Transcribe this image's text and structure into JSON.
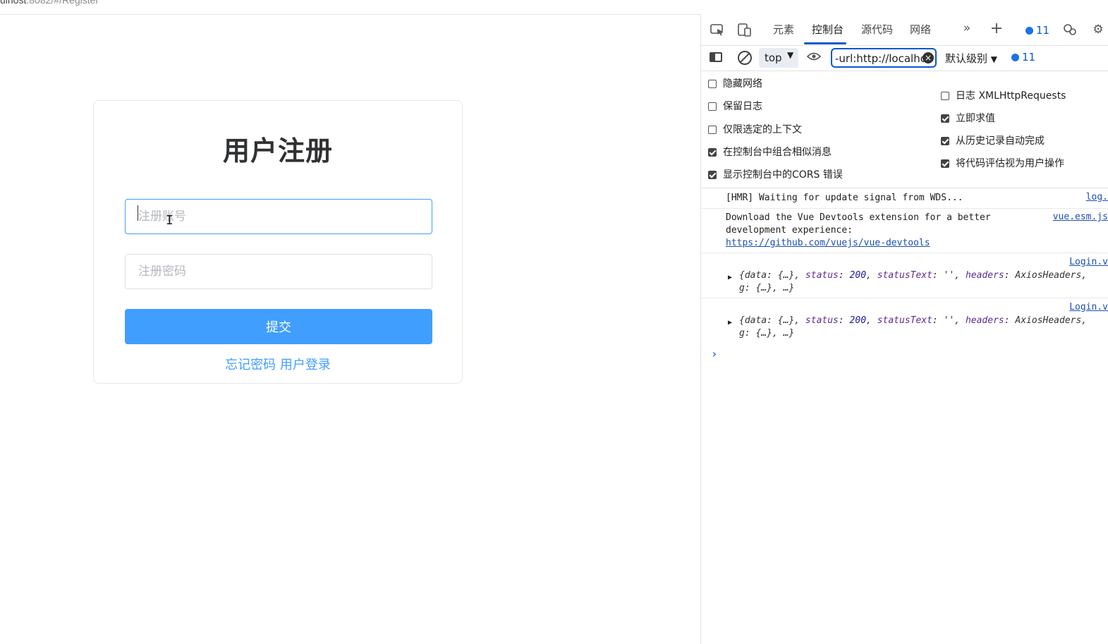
{
  "browser": {
    "url_host": "ulhost",
    "url_dim": ":8082/#/Register"
  },
  "register": {
    "title": "用户注册",
    "username_placeholder": "注册账号",
    "password_placeholder": "注册密码",
    "submit_label": "提交",
    "forgot_label": "忘记密码",
    "login_label": "用户登录"
  },
  "devtools": {
    "tabs": [
      "元素",
      "控制台",
      "源代码",
      "网络"
    ],
    "active_tab": "控制台",
    "issue_count": "11",
    "toolbar": {
      "context": "top",
      "filter_value": "-url:http://localhos",
      "level": "默认级别",
      "message_count": "11"
    },
    "settings_left": [
      {
        "label": "隐藏网络",
        "checked": false
      },
      {
        "label": "保留日志",
        "checked": false
      },
      {
        "label": "仅限选定的上下文",
        "checked": false
      },
      {
        "label": "在控制台中组合相似消息",
        "checked": true
      },
      {
        "label": "显示控制台中的CORS 错误",
        "checked": true
      }
    ],
    "settings_right": [
      {
        "label": "日志 XMLHttpRequests",
        "checked": false
      },
      {
        "label": "立即求值",
        "checked": true
      },
      {
        "label": "从历史记录自动完成",
        "checked": true
      },
      {
        "label": "将代码评估视为用户操作",
        "checked": true
      }
    ],
    "console": {
      "msg1_text": "[HMR] Waiting for update signal from WDS...",
      "msg1_src": "log.",
      "msg2_line1": "Download the Vue Devtools extension for a better",
      "msg2_line2": "development experience:",
      "msg2_link": "https://github.com/vuejs/vue-devtools",
      "msg2_src": "vue.esm.js",
      "msg3_src": "Login.v",
      "msg4_src": "Login.v",
      "obj_open": "{data: {…}, ",
      "obj_status_key": "status",
      "obj_status_val": "200",
      "obj_statustext_key": "statusText",
      "obj_statustext_val": "''",
      "obj_headers_key": "headers",
      "obj_headers_val": "AxiosHeaders,",
      "obj_tail": "g: {…}, …}"
    }
  }
}
